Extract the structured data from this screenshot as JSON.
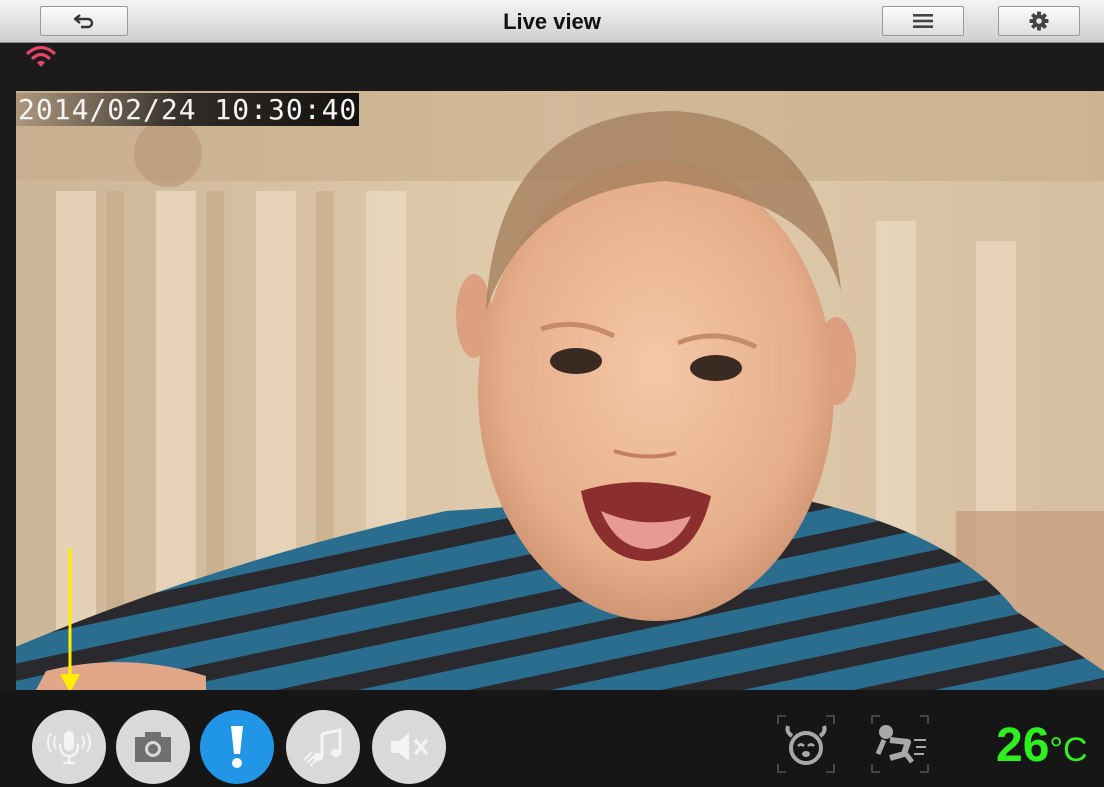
{
  "header": {
    "title": "Live view"
  },
  "icons": {
    "back": "back-arrow-icon",
    "menu": "hamburger-menu-icon",
    "settings": "gear-icon",
    "wifi": "wifi-signal-icon",
    "mic": "microphone-icon",
    "camera": "camera-icon",
    "alert": "exclamation-icon",
    "lullaby": "music-note-icon",
    "mute": "speaker-mute-icon",
    "sound_sensor": "crying-baby-icon",
    "motion_sensor": "crawling-baby-icon"
  },
  "video": {
    "timestamp": "2014/02/24 10:30:40"
  },
  "status": {
    "temperature": "26",
    "temperature_unit": "°C"
  },
  "colors": {
    "wifi": "#e8436b",
    "temperature": "#2df01e",
    "active_button": "#2196e6",
    "annotation_arrow": "#ffee00"
  }
}
